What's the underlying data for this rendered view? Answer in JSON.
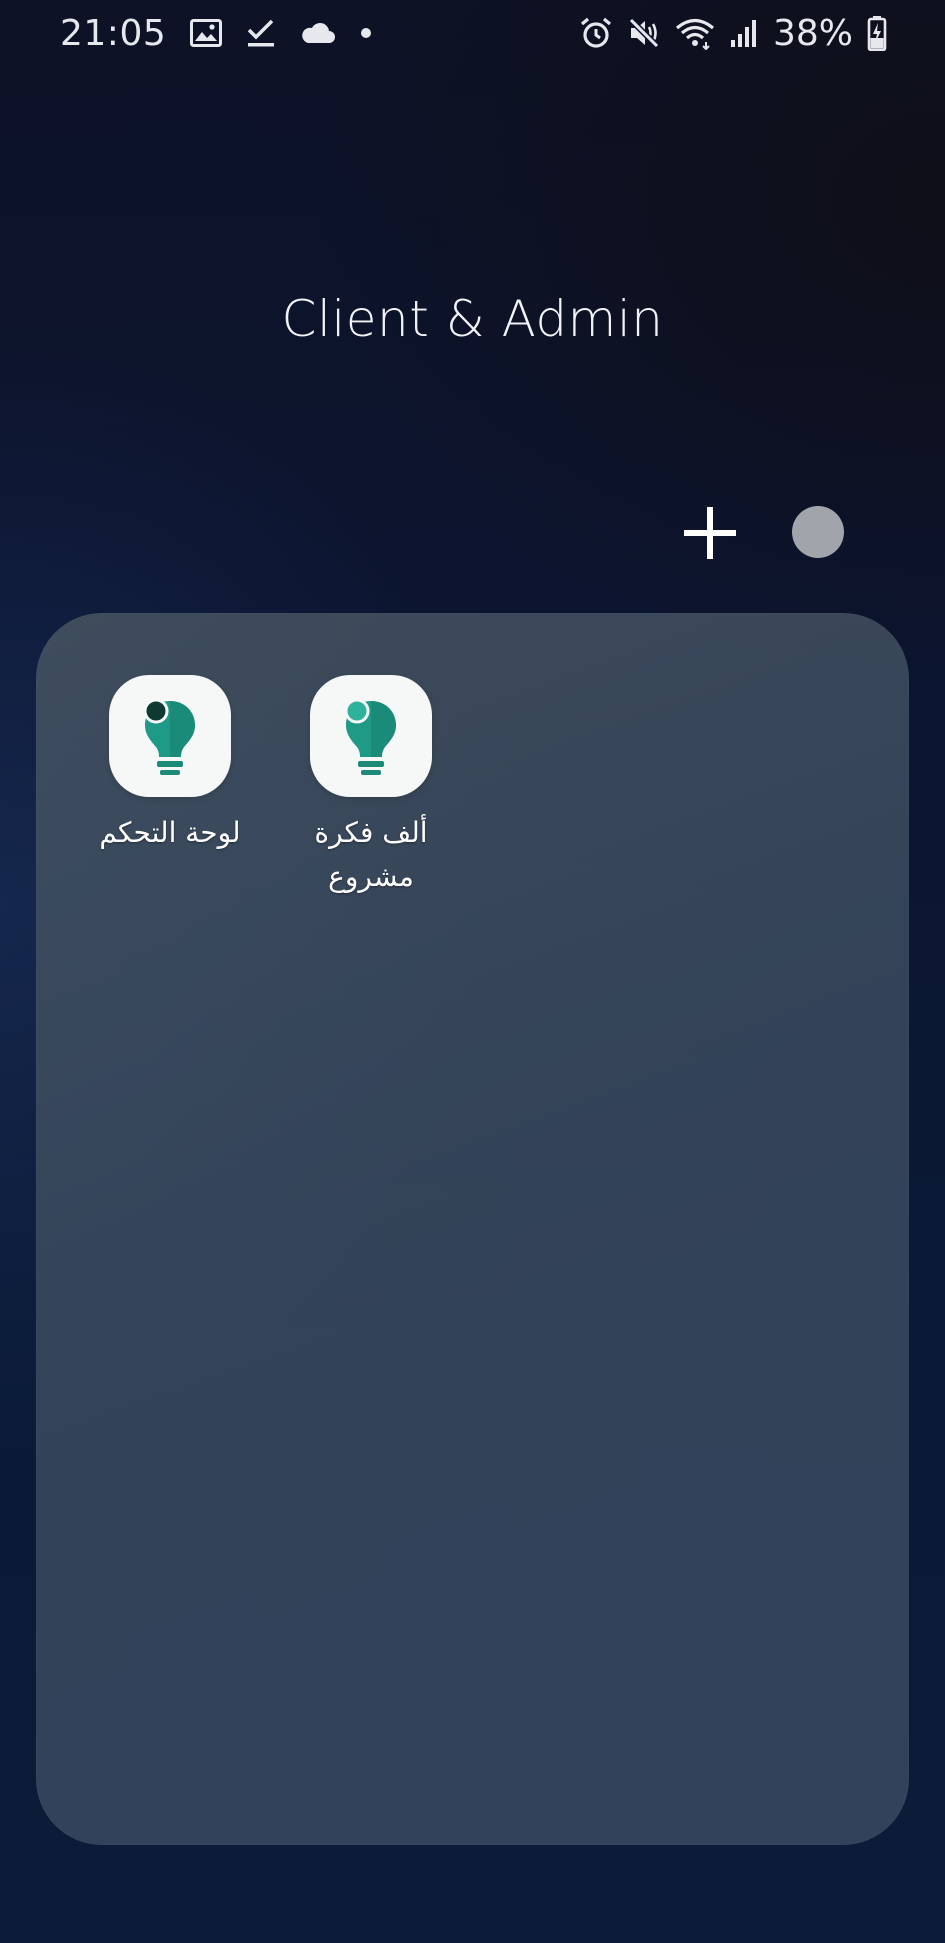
{
  "status_bar": {
    "time": "21:05",
    "battery": "38%",
    "notification_icons": [
      "image-icon",
      "checkmark-icon",
      "cloud-icon",
      "dot-icon"
    ],
    "system_icons": [
      "alarm-icon",
      "mute-icon",
      "wifi-icon",
      "signal-icon",
      "battery-charging-icon"
    ]
  },
  "folder": {
    "title": "Client & Admin",
    "add_icon": "plus-icon",
    "color_dot": "#a2a4ab",
    "apps": [
      {
        "label": "لوحة التحكم",
        "icon": "lightbulb-icon",
        "accent": "#0f3a33"
      },
      {
        "label": "ألف فكرة\nمشروع",
        "icon": "lightbulb-icon",
        "accent": "#2fb29b"
      }
    ]
  },
  "colors": {
    "bulb_teal": "#1f9a86",
    "bulb_base": "#1d8a78",
    "icon_background": "#f5f8f7"
  }
}
